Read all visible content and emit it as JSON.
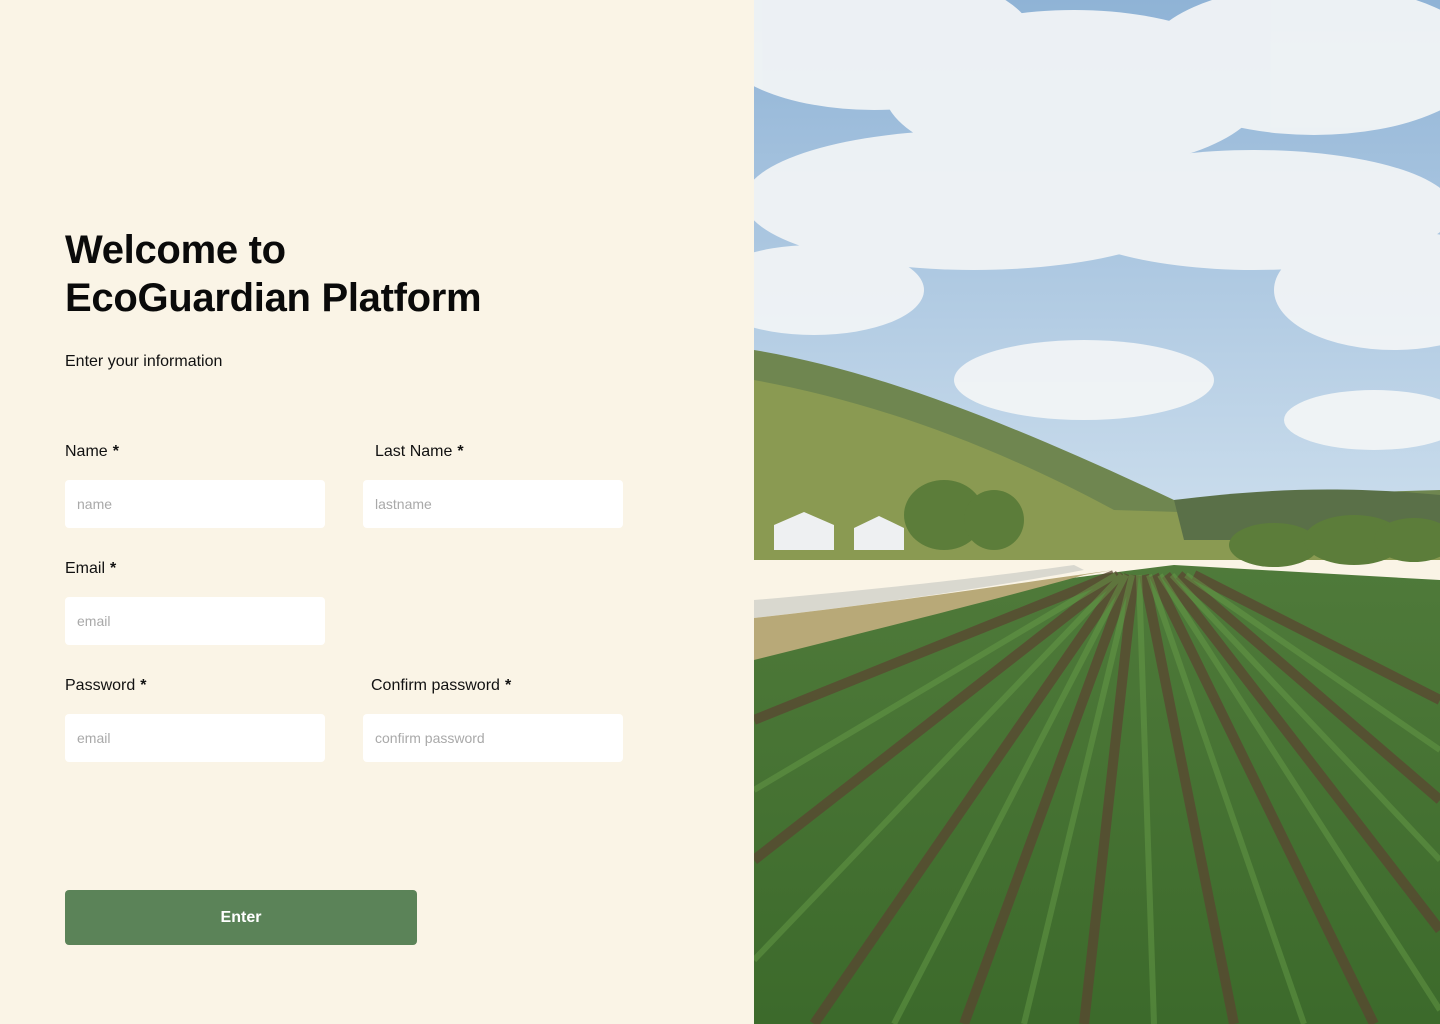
{
  "heading": {
    "title": "Welcome to\nEcoGuardian Platform",
    "subtitle": "Enter your information"
  },
  "form": {
    "name": {
      "label": "Name",
      "required_mark": "*",
      "placeholder": "name"
    },
    "last_name": {
      "label": "Last Name",
      "required_mark": "*",
      "placeholder": "lastname"
    },
    "email": {
      "label": "Email",
      "required_mark": "*",
      "placeholder": "email"
    },
    "password": {
      "label": "Password",
      "required_mark": "*",
      "placeholder": "email"
    },
    "confirm_password": {
      "label": "Confirm password",
      "required_mark": "*",
      "placeholder": "confirm password"
    },
    "submit_label": "Enter"
  },
  "colors": {
    "background": "#faf4e6",
    "button": "#5b8358",
    "input": "#ffffff"
  },
  "hero_image": {
    "subject": "farm-field-photo"
  }
}
